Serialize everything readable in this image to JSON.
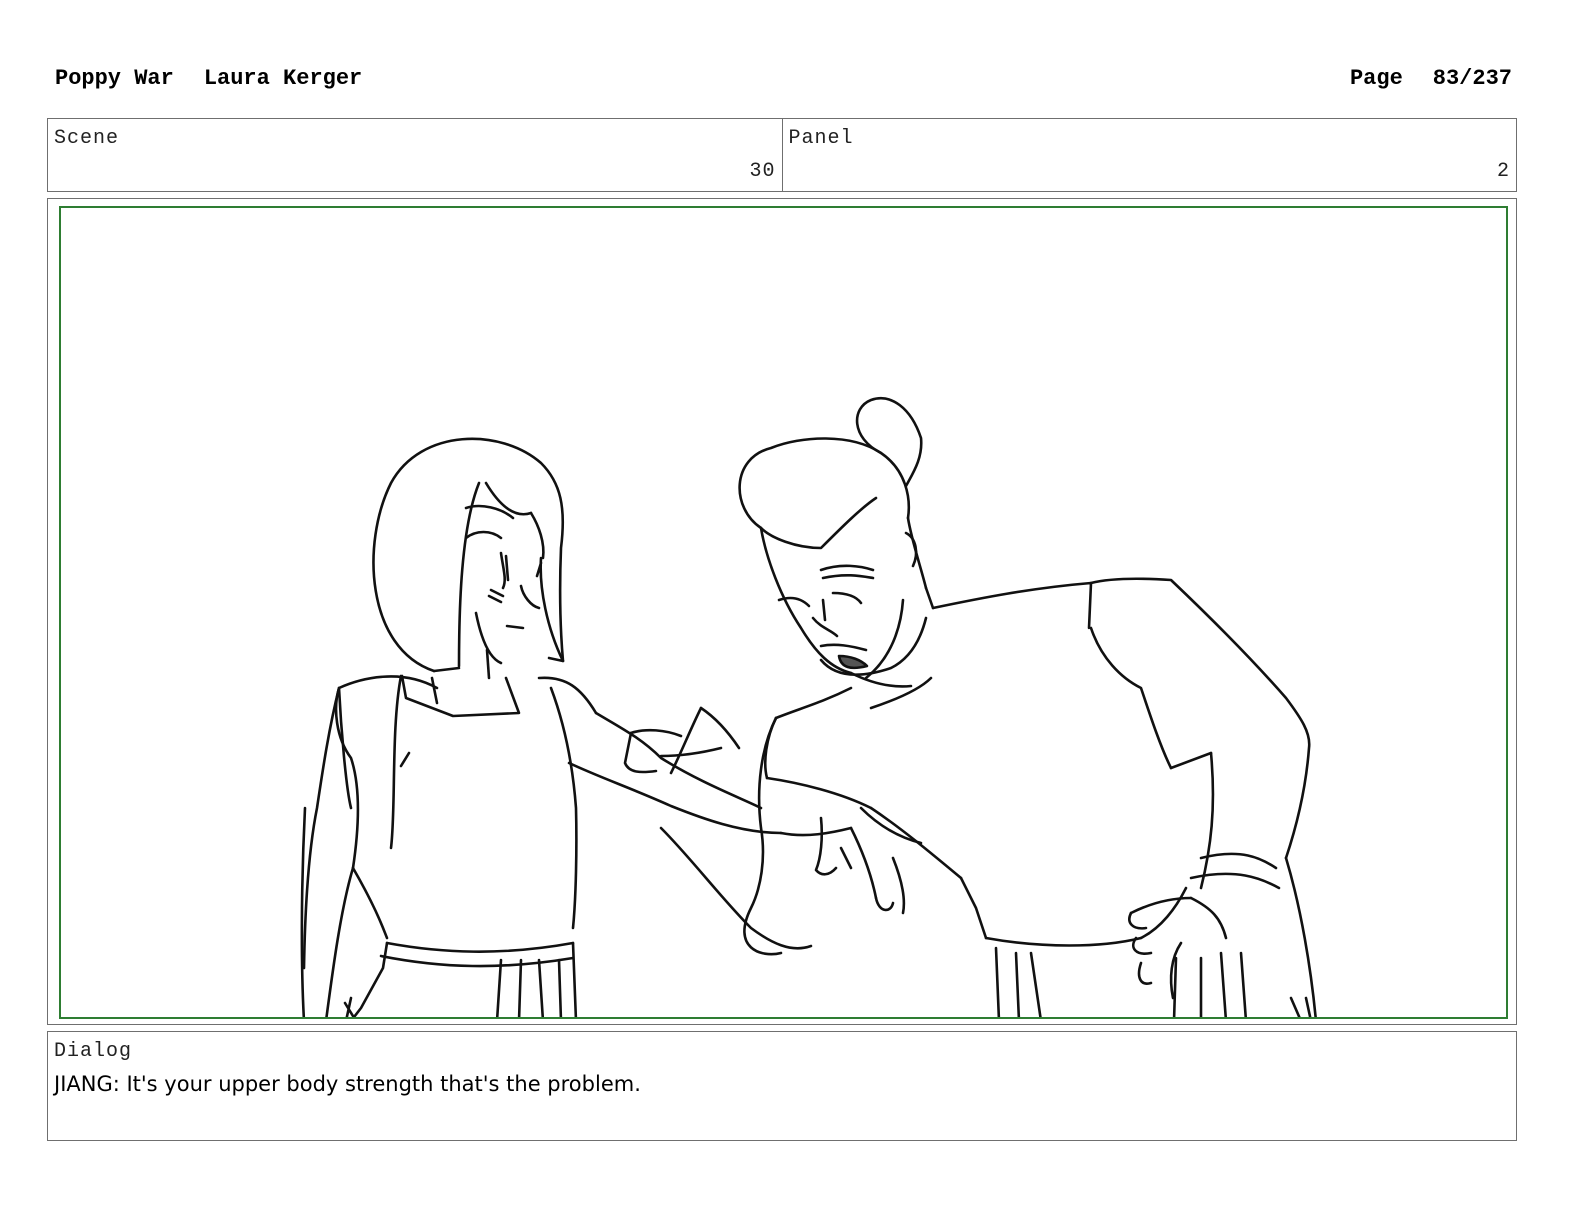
{
  "header": {
    "project_title": "Poppy War",
    "author": "Laura Kerger",
    "page_label": "Page",
    "page_number": "83/237"
  },
  "info": {
    "scene_label": "Scene",
    "scene_value": "30",
    "panel_label": "Panel",
    "panel_value": "2"
  },
  "dialog": {
    "label": "Dialog",
    "text": "JIANG: It's your upper body strength that's the problem."
  },
  "colors": {
    "panel_border": "#2e7d32",
    "frame_border": "#6f6f6f"
  }
}
